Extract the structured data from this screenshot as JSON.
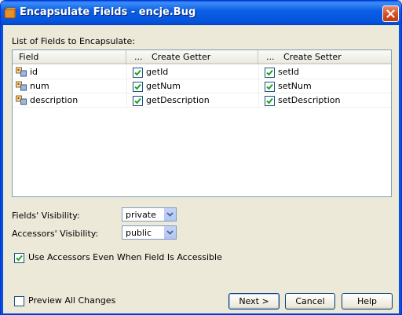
{
  "window": {
    "title": "Encapsulate Fields - encje.Bug",
    "icon": "netbeans-app-icon"
  },
  "list_label": "List of Fields to Encapsulate:",
  "table": {
    "columns": {
      "field": "Field",
      "getter_dots": "...",
      "getter": "Create Getter",
      "setter_dots": "...",
      "setter": "Create Setter"
    },
    "rows": [
      {
        "field": "id",
        "getter": "getId",
        "getter_checked": true,
        "setter": "setId",
        "setter_checked": true
      },
      {
        "field": "num",
        "getter": "getNum",
        "getter_checked": true,
        "setter": "setNum",
        "setter_checked": true
      },
      {
        "field": "description",
        "getter": "getDescription",
        "getter_checked": true,
        "setter": "setDescription",
        "setter_checked": true
      }
    ]
  },
  "fields_visibility": {
    "label": "Fields' Visibility:",
    "value": "private"
  },
  "accessors_visibility": {
    "label": "Accessors' Visibility:",
    "value": "public"
  },
  "use_accessors": {
    "label": "Use Accessors Even When Field Is Accessible",
    "checked": true
  },
  "preview": {
    "label": "Preview All Changes",
    "checked": false
  },
  "buttons": {
    "next": "Next >",
    "cancel": "Cancel",
    "help": "Help"
  },
  "colors": {
    "titlebar": "#0553dc",
    "face": "#ece9d8",
    "check": "#21a121"
  }
}
